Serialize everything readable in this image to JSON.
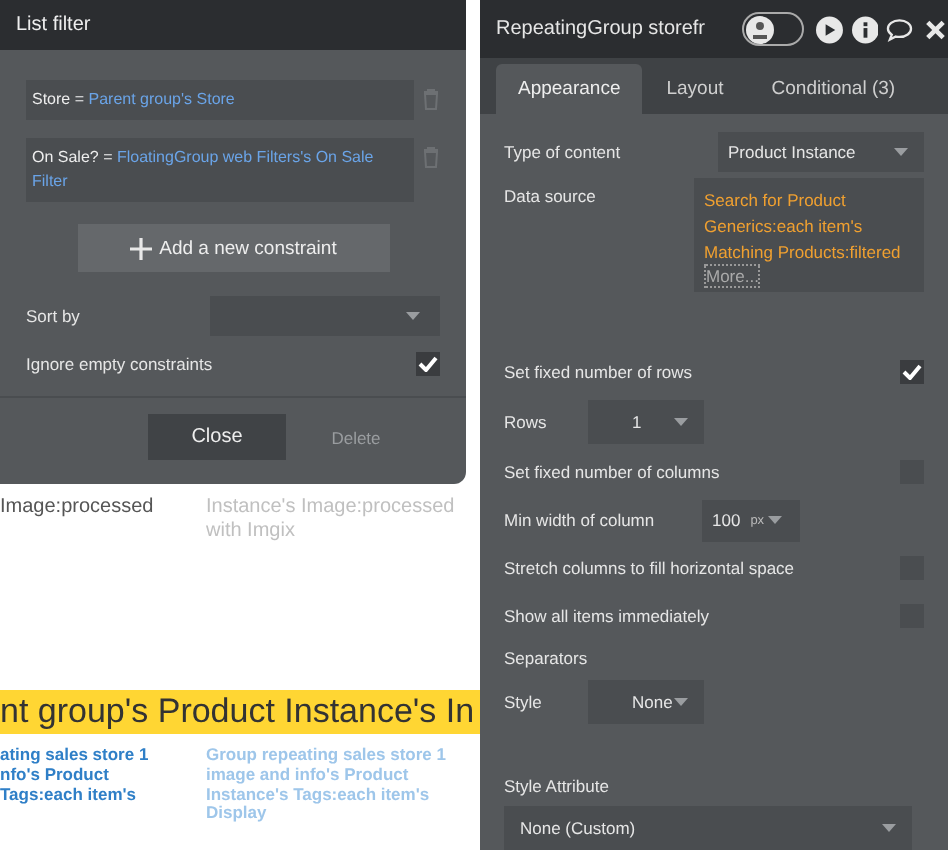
{
  "canvas": {
    "blocks": [
      {
        "kind": "pair",
        "left": "Image:processed",
        "right": "Instance's Image:processed with Imgix"
      },
      {
        "kind": "banner",
        "text": "nt group's Product Instance's In"
      },
      {
        "kind": "links",
        "left": "ating sales store 1\nnfo's Product\nTags:each item's",
        "right": "Group repeating sales store 1 image and info's Product Instance's Tags:each item's Display"
      }
    ]
  },
  "list_filter": {
    "title": "List filter",
    "constraints": [
      {
        "label": "Store =",
        "value": "Parent group's Store"
      },
      {
        "label": "On Sale? =",
        "value": "FloatingGroup web Filters's On Sale Filter"
      }
    ],
    "add_button": "Add a new constraint",
    "sort_by": {
      "label": "Sort by"
    },
    "ignore_empty": {
      "label": "Ignore empty constraints",
      "checked": true
    },
    "buttons": [
      {
        "label": "Close",
        "kind": "primary"
      },
      {
        "label": "Delete",
        "kind": "secondary"
      }
    ]
  },
  "inspector": {
    "title": "RepeatingGroup storefr",
    "preview_toggle": {
      "on": false
    },
    "tabs": [
      {
        "label": "Appearance",
        "selected": true
      },
      {
        "label": "Layout",
        "selected": false
      },
      {
        "label": "Conditional (3)",
        "selected": false
      }
    ],
    "rows": [
      {
        "kind": "dropdown",
        "label": "Type of content",
        "value": "Product Instance"
      },
      {
        "kind": "expression",
        "label": "Data source",
        "value": "Search for Product Generics:each item's Matching Products:filtered",
        "more": "More..."
      },
      {
        "kind": "checkbox",
        "label": "Set fixed number of rows",
        "checked": true
      },
      {
        "kind": "small_dropdown",
        "label": "Rows",
        "value": "1"
      },
      {
        "kind": "checkbox",
        "label": "Set fixed number of columns",
        "checked": false
      },
      {
        "kind": "unit",
        "label": "Min width of column",
        "value": "100",
        "unit": "px"
      },
      {
        "kind": "checkbox",
        "label": "Stretch columns to fill horizontal space",
        "checked": false
      },
      {
        "kind": "checkbox",
        "label": "Show all items immediately",
        "checked": false
      },
      {
        "kind": "heading",
        "label": "Separators"
      },
      {
        "kind": "small_dropdown",
        "label": "Style",
        "value": "None"
      },
      {
        "kind": "spacer"
      },
      {
        "kind": "heading",
        "label": "Style Attribute"
      },
      {
        "kind": "wide_dropdown",
        "value": "None (Custom)"
      }
    ]
  }
}
